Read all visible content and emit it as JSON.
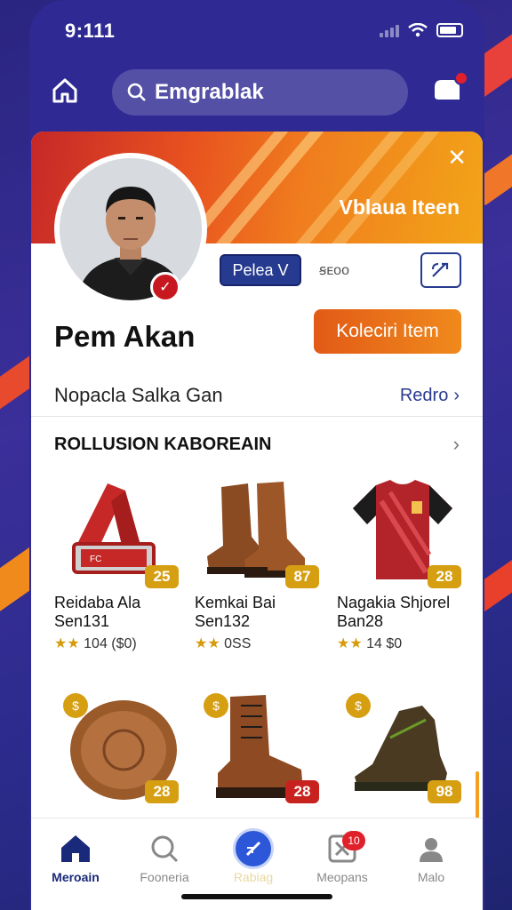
{
  "status_bar": {
    "time": "9:111"
  },
  "search": {
    "value": "Emgrablak"
  },
  "banner": {
    "title": "Vblaua Iteen"
  },
  "profile": {
    "name": "Pem Akan",
    "tag_button": "Pelea V",
    "tag_text": "ꞩᴇᴏᴏ"
  },
  "actions": {
    "collect_label": "Koleciri Item"
  },
  "info_row": {
    "text": "Nopacla Salka Gan",
    "link": "Redro"
  },
  "section": {
    "title": "ROLLUSION KABOREAIN"
  },
  "items": [
    {
      "name_line1": "Reidaba Ala",
      "name_line2": "Sen131",
      "rating": "★★",
      "rating_text": "104 ($0)",
      "price": "25",
      "icon": "wristband"
    },
    {
      "name_line1": "Kemkai Bai",
      "name_line2": "Sen132",
      "rating": "★★",
      "rating_text": "0SS",
      "price": "87",
      "icon": "boots"
    },
    {
      "name_line1": "Nagakia Shjorel",
      "name_line2": "Ban28",
      "rating": "★★",
      "rating_text": "14 $0",
      "price": "28",
      "icon": "jersey"
    },
    {
      "price": "28",
      "fav": "$",
      "icon": "bronze-medal"
    },
    {
      "price": "28",
      "fav": "$",
      "icon": "brown-boot"
    },
    {
      "price": "98",
      "fav": "$",
      "icon": "hiking-shoe"
    }
  ],
  "tabs": [
    {
      "label": "Meroain",
      "icon": "home-icon"
    },
    {
      "label": "Fooneria",
      "icon": "search-icon"
    },
    {
      "label": "Rabiag",
      "icon": "compass-icon"
    },
    {
      "label": "Meopans",
      "icon": "messages-icon",
      "badge": "10"
    },
    {
      "label": "Malo",
      "icon": "profile-icon"
    }
  ],
  "colors": {
    "accent": "#263a8f",
    "orange": "#f08a1c",
    "gold": "#d69f12",
    "red": "#c8221e"
  }
}
